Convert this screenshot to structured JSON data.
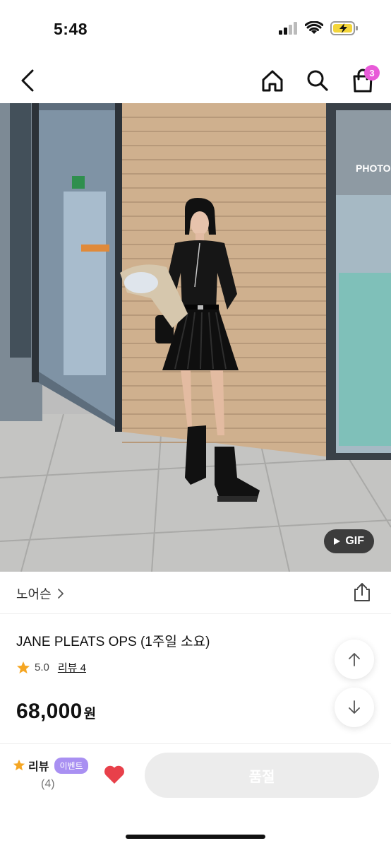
{
  "status_bar": {
    "time": "5:48"
  },
  "nav": {
    "cart_count": "3"
  },
  "photo": {
    "gif_label": "GIF",
    "store_sign": "PHOTO"
  },
  "brand": {
    "name": "노어슨",
    "chevron": "›"
  },
  "product": {
    "name": "JANE PLEATS OPS (1주일 소요)",
    "rating": "5.0",
    "review_link": "리뷰 4",
    "price": "68,000",
    "price_unit": "원"
  },
  "bottom_bar": {
    "review_label": "리뷰",
    "event_badge": "이벤트",
    "review_count": "(4)",
    "soldout_label": "품절"
  },
  "colors": {
    "badge_pink": "#e85ad8",
    "star": "#f5a623",
    "heart": "#e8404a",
    "event_purple": "#a990f2",
    "soldout_gray": "#ececec"
  }
}
